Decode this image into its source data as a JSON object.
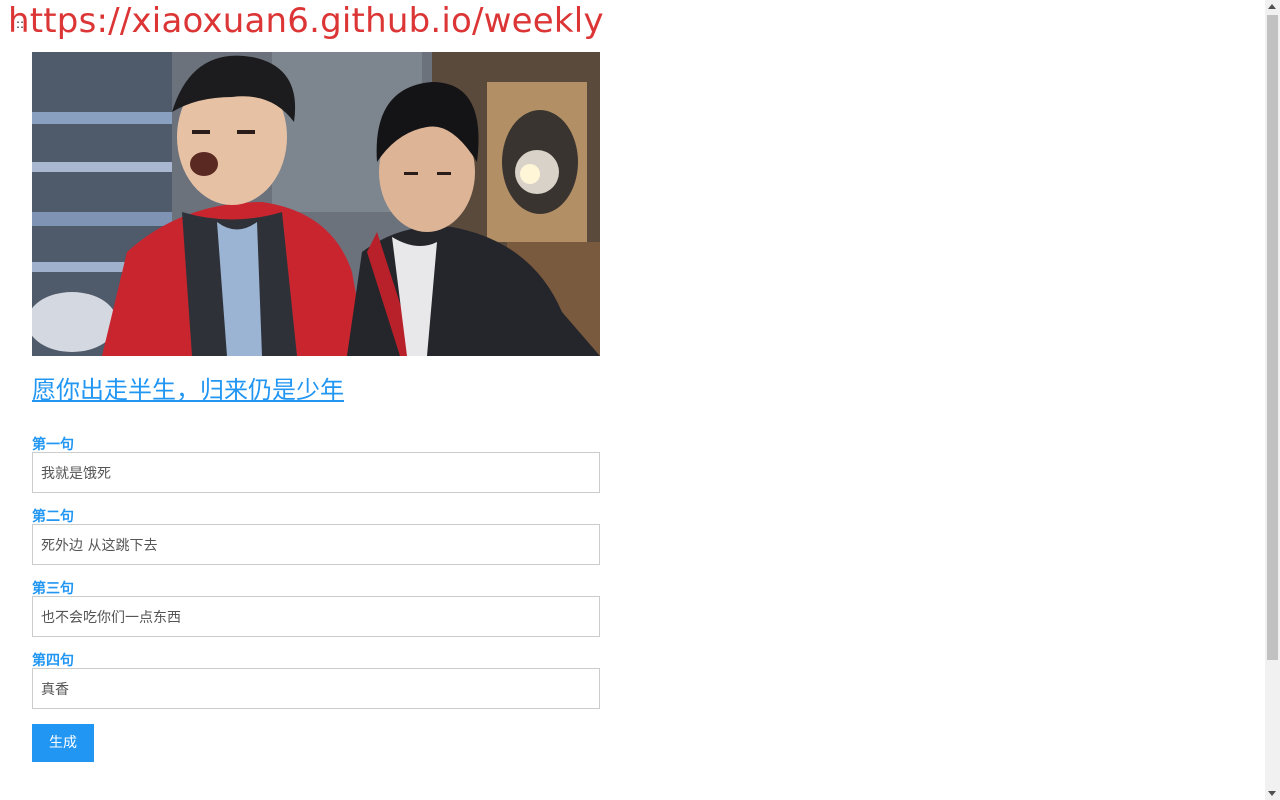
{
  "banner": {
    "url_text": "https://xiaoxuan6.github.io/weekly",
    "corner_mark": "::"
  },
  "hero": {
    "icon": "meme-photo-two-boys"
  },
  "title": {
    "text": "愿你出走半生，归来仍是少年"
  },
  "form": {
    "fields": [
      {
        "label": "第一句",
        "value": "我就是饿死"
      },
      {
        "label": "第二句",
        "value": "死外边 从这跳下去"
      },
      {
        "label": "第三句",
        "value": "也不会吃你们一点东西"
      },
      {
        "label": "第四句",
        "value": "真香"
      }
    ],
    "submit_label": "生成"
  },
  "colors": {
    "accent": "#2196f3",
    "banner": "#dc3535"
  }
}
